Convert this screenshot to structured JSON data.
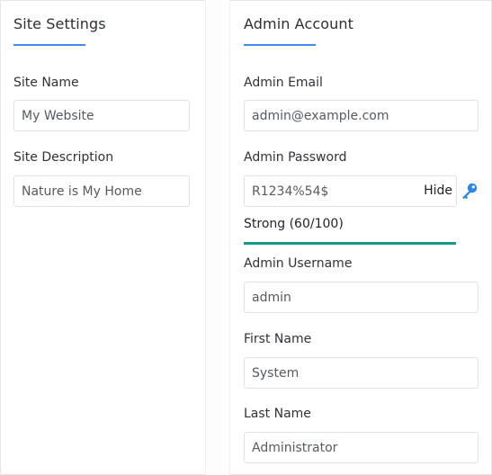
{
  "site_settings": {
    "title": "Site Settings",
    "site_name_label": "Site Name",
    "site_name_value": "My Website",
    "site_description_label": "Site Description",
    "site_description_value": "Nature is My Home"
  },
  "admin_account": {
    "title": "Admin Account",
    "email_label": "Admin Email",
    "email_value": "admin@example.com",
    "password_label": "Admin Password",
    "password_value": "R1234%54$",
    "hide_label": "Hide",
    "key_icon": "key-icon",
    "strength_text": "Strong (60/100)",
    "strength_score": 60,
    "strength_color": "#149a8e",
    "username_label": "Admin Username",
    "username_value": "admin",
    "first_name_label": "First Name",
    "first_name_value": "System",
    "last_name_label": "Last Name",
    "last_name_value": "Administrator"
  },
  "colors": {
    "accent": "#3f8cf0",
    "key_icon_color": "#2f86e8"
  }
}
